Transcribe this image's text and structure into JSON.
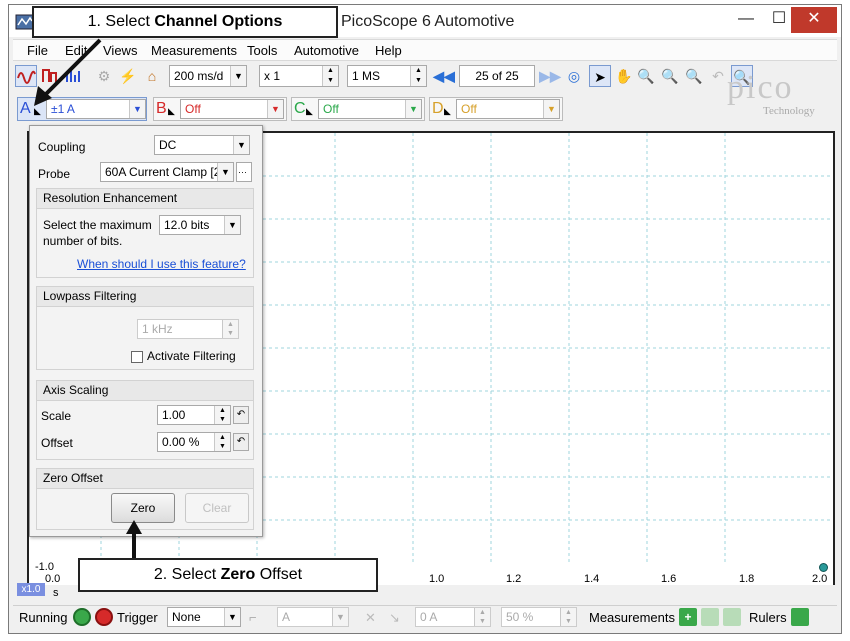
{
  "window": {
    "title": "PicoScope 6 Automotive",
    "min": "—",
    "max": "☐",
    "close": "✕"
  },
  "menu": [
    "File",
    "Edit",
    "Views",
    "Measurements",
    "Tools",
    "Automotive",
    "Help"
  ],
  "toolbar": {
    "timebase": "200 ms/d",
    "zoom": "x 1",
    "samples": "1 MS",
    "buffer": "25 of 25"
  },
  "channels": {
    "a": {
      "letter": "A",
      "range": "±1 A",
      "color": "#2a4fd6"
    },
    "b": {
      "letter": "B",
      "range": "Off",
      "color": "#d62a2a"
    },
    "c": {
      "letter": "C",
      "range": "Off",
      "color": "#2aa84a"
    },
    "d": {
      "letter": "D",
      "range": "Off",
      "color": "#d6a02a"
    }
  },
  "logo": {
    "name": "pico",
    "sub": "Technology"
  },
  "panel": {
    "coupling_label": "Coupling",
    "coupling_value": "DC",
    "probe_label": "Probe",
    "probe_value": "60A Current Clamp [2",
    "probe_more": "···",
    "resolution": {
      "title": "Resolution Enhancement",
      "text": "Select the maximum number of bits.",
      "bits": "12.0 bits",
      "link": "When should I use this feature?"
    },
    "lowpass": {
      "title": "Lowpass Filtering",
      "freq": "1 kHz",
      "checkbox": "Activate Filtering"
    },
    "axis": {
      "title": "Axis Scaling",
      "scale_label": "Scale",
      "scale_value": "1.00",
      "offset_label": "Offset",
      "offset_value": "0.00 %"
    },
    "zero": {
      "title": "Zero Offset",
      "zero_btn": "Zero",
      "clear_btn": "Clear"
    }
  },
  "axes": {
    "y_bottom": "-1.0",
    "x_ticks": [
      "0.0",
      "1.0",
      "1.2",
      "1.4",
      "1.6",
      "1.8",
      "2.0"
    ],
    "x_unit": "s",
    "zoom_badge": "x1.0"
  },
  "status": {
    "running": "Running",
    "trigger": "Trigger",
    "trigger_mode": "None",
    "trigger_source": "A",
    "threshold": "0 A",
    "pretrigger": "50 %",
    "measurements": "Measurements",
    "rulers": "Rulers"
  },
  "callouts": {
    "step1_prefix": "1. Select ",
    "step1_bold": "Channel Options",
    "step2_prefix": "2. Select ",
    "step2_bold": "Zero",
    "step2_suffix": " Offset"
  }
}
